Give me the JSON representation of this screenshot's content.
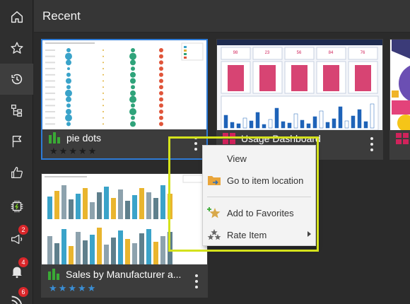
{
  "header": {
    "title": "Recent"
  },
  "nav": {
    "items": [
      {
        "icon": "home-icon"
      },
      {
        "icon": "star-icon"
      },
      {
        "icon": "history-icon"
      },
      {
        "icon": "hierarchy-icon"
      },
      {
        "icon": "flag-icon"
      },
      {
        "icon": "thumbs-up-icon"
      },
      {
        "icon": "chip-icon"
      },
      {
        "icon": "megaphone-icon",
        "badge": "2"
      },
      {
        "icon": "bell-icon",
        "badge": "4"
      },
      {
        "icon": "feed-icon",
        "badge": "6"
      }
    ]
  },
  "tiles": [
    {
      "name": "pie dots",
      "kind_icon": "bar-chart-icon",
      "rating": 0,
      "max_rating": 5
    },
    {
      "name": "Usage Dashboard",
      "kind_icon": "dashboard-icon",
      "rating": 0,
      "max_rating": 5
    },
    {
      "name": "",
      "kind_icon": "dashboard-icon"
    },
    {
      "name": "Sales by Manufacturer a...",
      "kind_icon": "bar-chart-icon",
      "rating": 5,
      "max_rating": 5
    }
  ],
  "dashboard_kpis": [
    "98",
    "23",
    "56",
    "84",
    "76"
  ],
  "menu": {
    "items": [
      {
        "label": "View",
        "icon": ""
      },
      {
        "label": "Go to item location",
        "icon": "folder-arrow-icon"
      },
      {
        "label": "Add to Favorites",
        "icon": "star-add-icon"
      },
      {
        "label": "Rate Item",
        "icon": "rate-stars-icon",
        "submenu": true
      }
    ]
  },
  "colors": {
    "accent": "#2e7bd6",
    "callout": "#d4e21c",
    "badge": "#d9262a",
    "chart_green": "#3aaa35",
    "star_gold": "#c8a93c",
    "star_blue": "#3a8fd6"
  }
}
